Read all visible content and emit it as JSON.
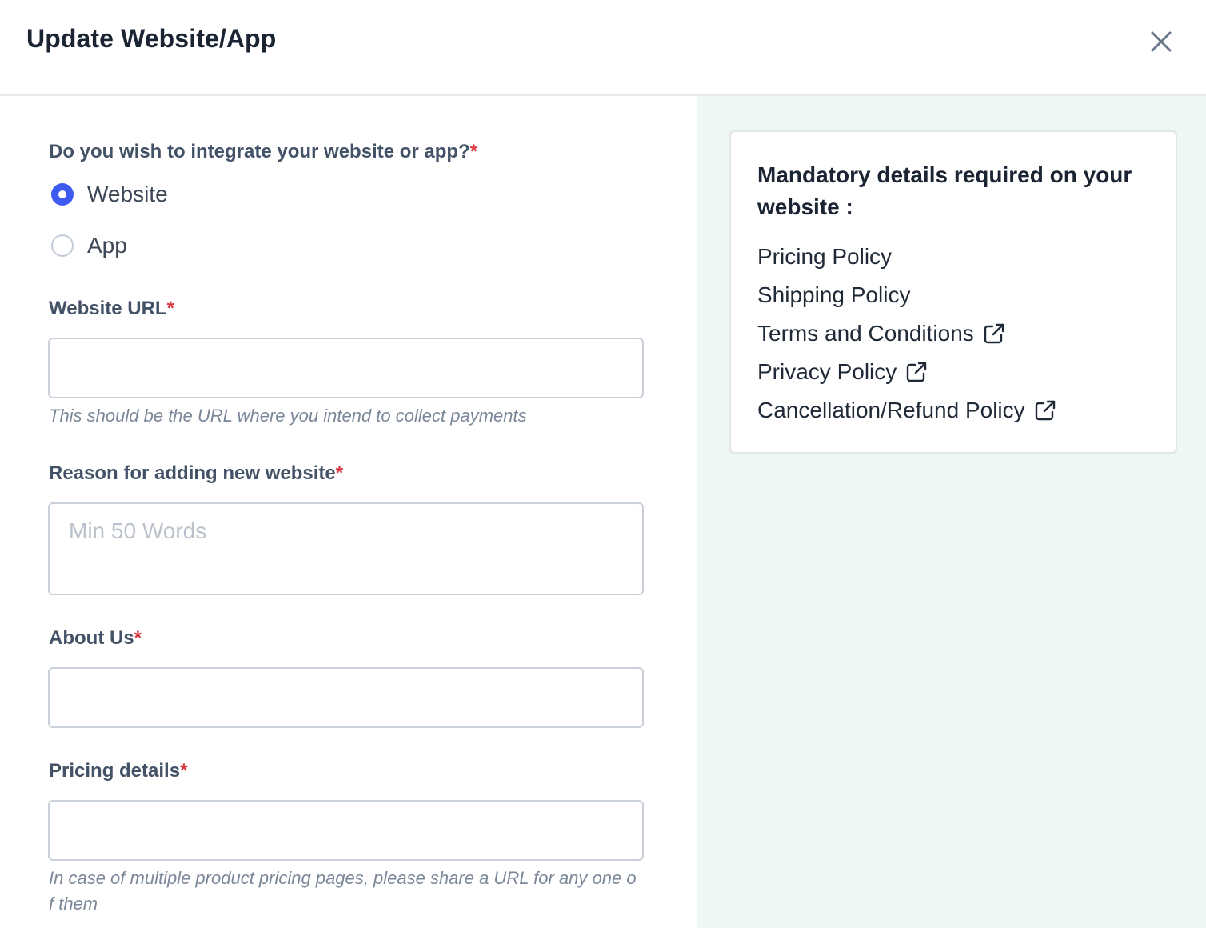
{
  "header": {
    "title": "Update Website/App"
  },
  "form": {
    "integration_question": "Do you wish to integrate your website or app?",
    "required_mark": "*",
    "options": [
      {
        "label": "Website",
        "selected": true
      },
      {
        "label": "App",
        "selected": false
      }
    ],
    "website_url": {
      "label": "Website URL",
      "value": "",
      "helper": "This should be the URL where you intend to collect payments"
    },
    "reason": {
      "label": "Reason for adding new website",
      "value": "",
      "placeholder": "Min 50 Words"
    },
    "about_us": {
      "label": "About Us",
      "value": ""
    },
    "pricing": {
      "label": "Pricing details",
      "value": "",
      "helper": "In case of multiple product pricing pages, please share a URL for any one of them"
    }
  },
  "sidebar": {
    "title": "Mandatory details required on your website :",
    "policies": [
      {
        "label": "Pricing Policy",
        "external_link": false
      },
      {
        "label": "Shipping Policy",
        "external_link": false
      },
      {
        "label": "Terms and Conditions",
        "external_link": true
      },
      {
        "label": "Privacy Policy",
        "external_link": true
      },
      {
        "label": "Cancellation/Refund Policy",
        "external_link": true
      }
    ]
  },
  "colors": {
    "accent": "#3d5af1",
    "required": "#d9363e",
    "sidebar_bg": "#eff7f5"
  },
  "icons": {
    "close": "close-icon",
    "external": "external-link-icon"
  }
}
